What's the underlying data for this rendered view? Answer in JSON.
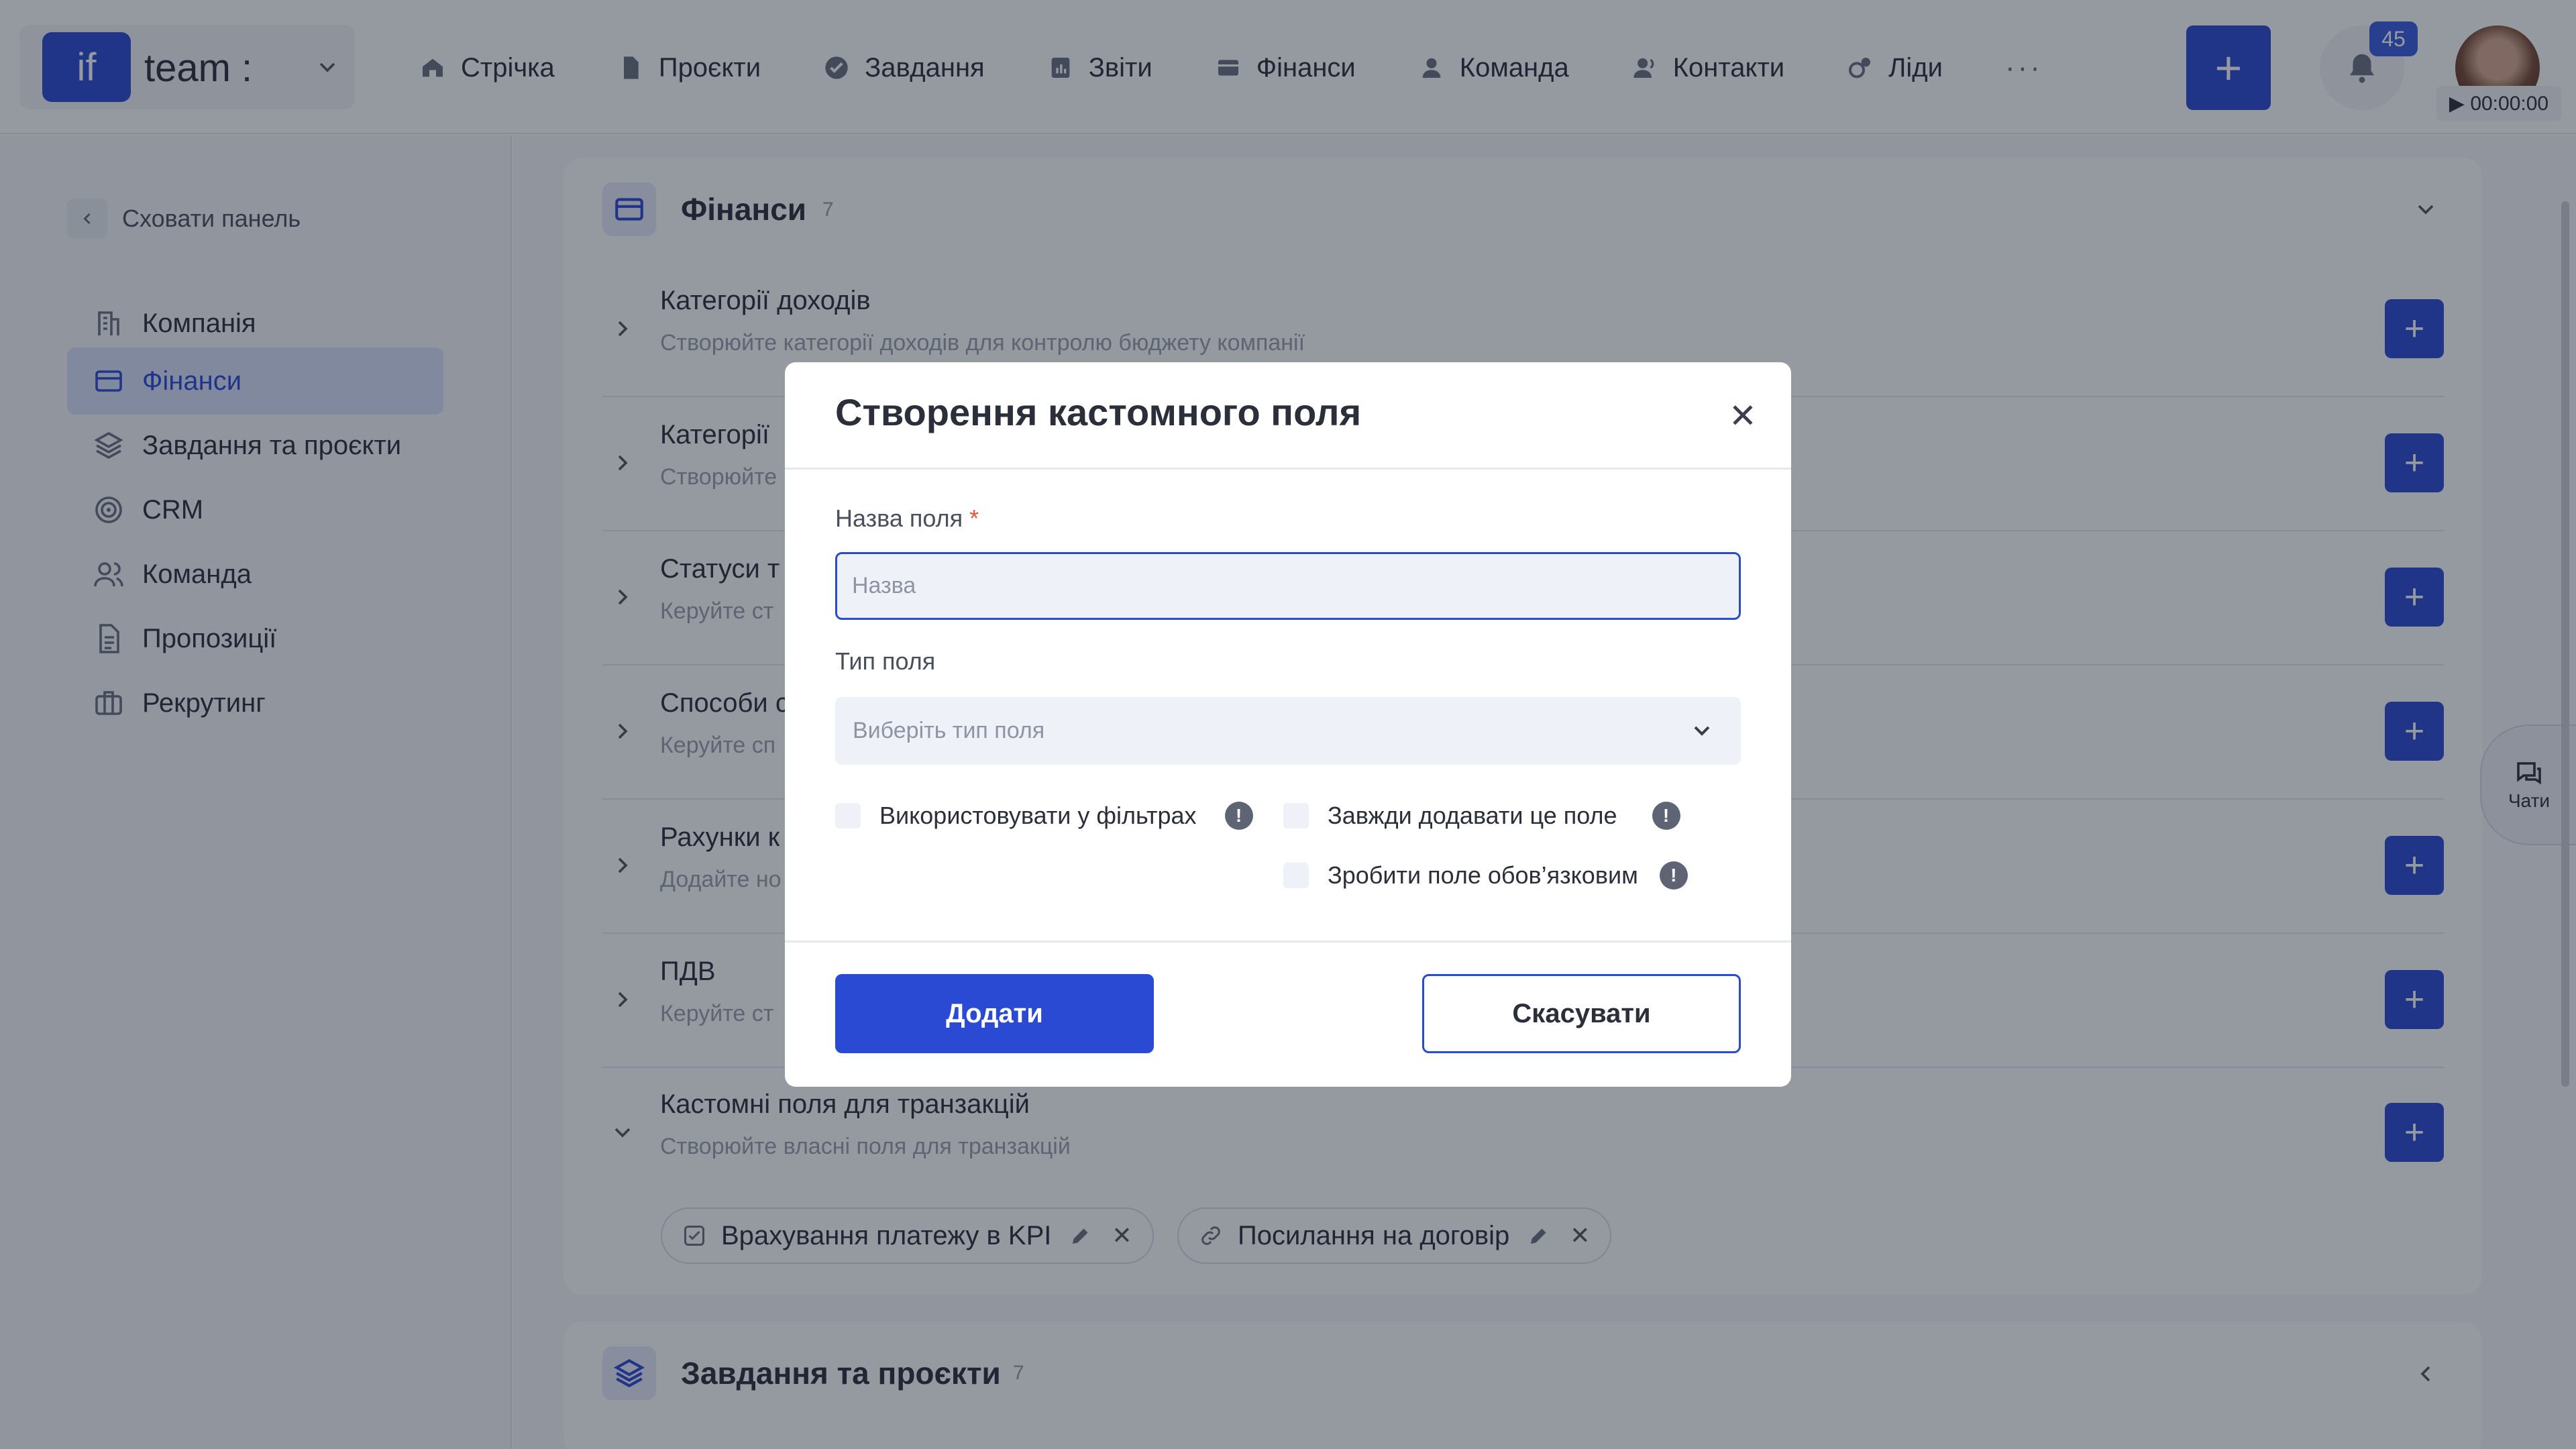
{
  "topbar": {
    "brand_logo": "if",
    "brand_name": "team :",
    "nav": [
      {
        "label": "Стрічка",
        "icon": "home-icon"
      },
      {
        "label": "Проєкти",
        "icon": "document-icon"
      },
      {
        "label": "Завдання",
        "icon": "check-circle-icon"
      },
      {
        "label": "Звіти",
        "icon": "report-icon"
      },
      {
        "label": "Фінанси",
        "icon": "wallet-icon"
      },
      {
        "label": "Команда",
        "icon": "user-icon"
      },
      {
        "label": "Контакти",
        "icon": "contacts-icon"
      },
      {
        "label": "Ліди",
        "icon": "leads-icon"
      }
    ],
    "more": "···",
    "add_label": "+",
    "notification_count": "45",
    "timer": "▶ 00:00:00"
  },
  "sidebar": {
    "hide_label": "Сховати панель",
    "items": [
      {
        "label": "Компанія",
        "icon": "company-icon"
      },
      {
        "label": "Фінанси",
        "icon": "card-icon"
      },
      {
        "label": "Завдання та проєкти",
        "icon": "layers-icon"
      },
      {
        "label": "CRM",
        "icon": "target-icon"
      },
      {
        "label": "Команда",
        "icon": "team-icon"
      },
      {
        "label": "Пропозиції",
        "icon": "proposal-icon"
      },
      {
        "label": "Рекрутинг",
        "icon": "briefcase-icon"
      }
    ]
  },
  "finance_section": {
    "title": "Фінанси",
    "count": "7",
    "rows": [
      {
        "title": "Категорії доходів",
        "subtitle": "Створюйте категорії доходів для контролю бюджету компанії"
      },
      {
        "title": "Категорії",
        "subtitle": "Створюйте"
      },
      {
        "title": "Статуси т",
        "subtitle": "Керуйте ст"
      },
      {
        "title": "Способи с",
        "subtitle": "Керуйте сп"
      },
      {
        "title": "Рахунки к",
        "subtitle": "Додайте но"
      },
      {
        "title": "ПДВ",
        "subtitle": "Керуйте ст"
      },
      {
        "title": "Кастомні поля для транзакцій",
        "subtitle": "Створюйте власні поля для транзакцій"
      }
    ],
    "chips": [
      {
        "label": "Врахування платежу в KPI",
        "icon": "checkbox-icon"
      },
      {
        "label": "Посилання на договір",
        "icon": "link-icon"
      }
    ]
  },
  "tasks_section": {
    "title": "Завдання та проєкти",
    "count": "7"
  },
  "chats_label": "Чати",
  "modal": {
    "title": "Створення кастомного поля",
    "field_name_label": "Назва поля",
    "required_mark": "*",
    "field_name_placeholder": "Назва",
    "field_type_label": "Тип поля",
    "field_type_placeholder": "Виберіть тип поля",
    "checks": {
      "use_in_filters": "Використовувати у фільтрах",
      "always_add": "Завжди додавати це поле",
      "make_required": "Зробити поле обов’язковим"
    },
    "info_mark": "!",
    "add_button": "Додати",
    "cancel_button": "Скасувати"
  },
  "colors": {
    "accent": "#2b4ad3",
    "overlay": "#141c2c"
  }
}
